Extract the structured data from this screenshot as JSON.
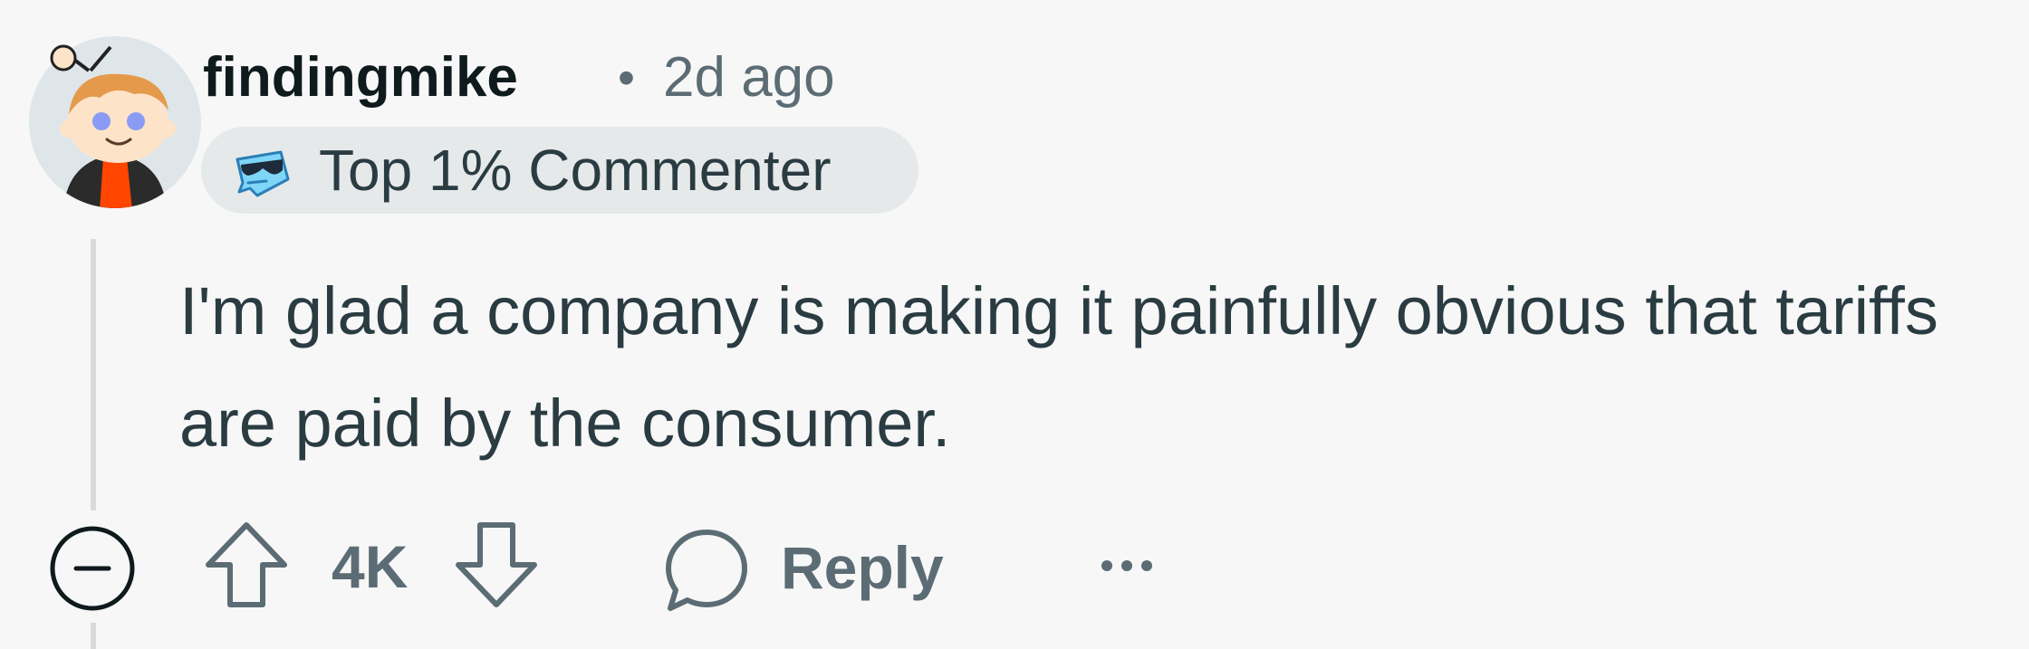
{
  "comment": {
    "author": "findingmike",
    "separator": "•",
    "timestamp": "2d ago",
    "flair": {
      "label": "Top 1% Commenter",
      "icon": "sunglasses-badge-icon"
    },
    "body": "I'm glad a company is making it painfully obvious that tariffs are paid by the consumer.",
    "score": "4K",
    "actions": {
      "reply_label": "Reply",
      "collapse_icon": "minus-circle-icon",
      "upvote_icon": "upvote-arrow-icon",
      "downvote_icon": "downvote-arrow-icon",
      "reply_icon": "speech-bubble-icon",
      "more_icon": "ellipsis-icon"
    }
  },
  "colors": {
    "background": "#f7f7f7",
    "username": "#0f1a1c",
    "meta": "#5c6c74",
    "body_text": "#2a3c42",
    "flair_bg": "#e6e9ea",
    "thread_line": "#d7dbdd",
    "avatar_accent": "#ff4500"
  }
}
